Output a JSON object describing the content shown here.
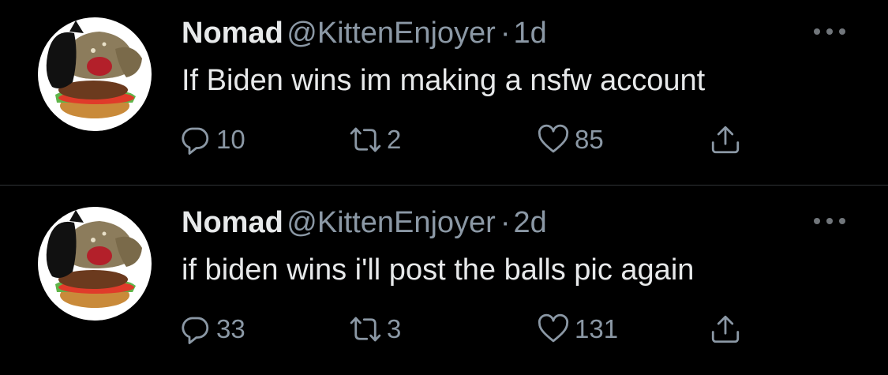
{
  "tweets": [
    {
      "name": "Nomad",
      "handle": "@KittenEnjoyer",
      "separator": "·",
      "time": "1d",
      "text": "If Biden wins im making a nsfw account",
      "replies": "10",
      "retweets": "2",
      "likes": "85"
    },
    {
      "name": "Nomad",
      "handle": "@KittenEnjoyer",
      "separator": "·",
      "time": "2d",
      "text": "if biden wins i'll post the balls pic again",
      "replies": "33",
      "retweets": "3",
      "likes": "131"
    }
  ],
  "icons": {
    "reply": "reply-icon",
    "retweet": "retweet-icon",
    "like": "heart-icon",
    "share": "share-icon",
    "more": "more-icon",
    "avatar": "burger-cat-avatar"
  },
  "colors": {
    "background": "#000000",
    "primary_text": "#e7e9ea",
    "secondary_text": "#8b98a5",
    "divider": "#2f3336"
  }
}
